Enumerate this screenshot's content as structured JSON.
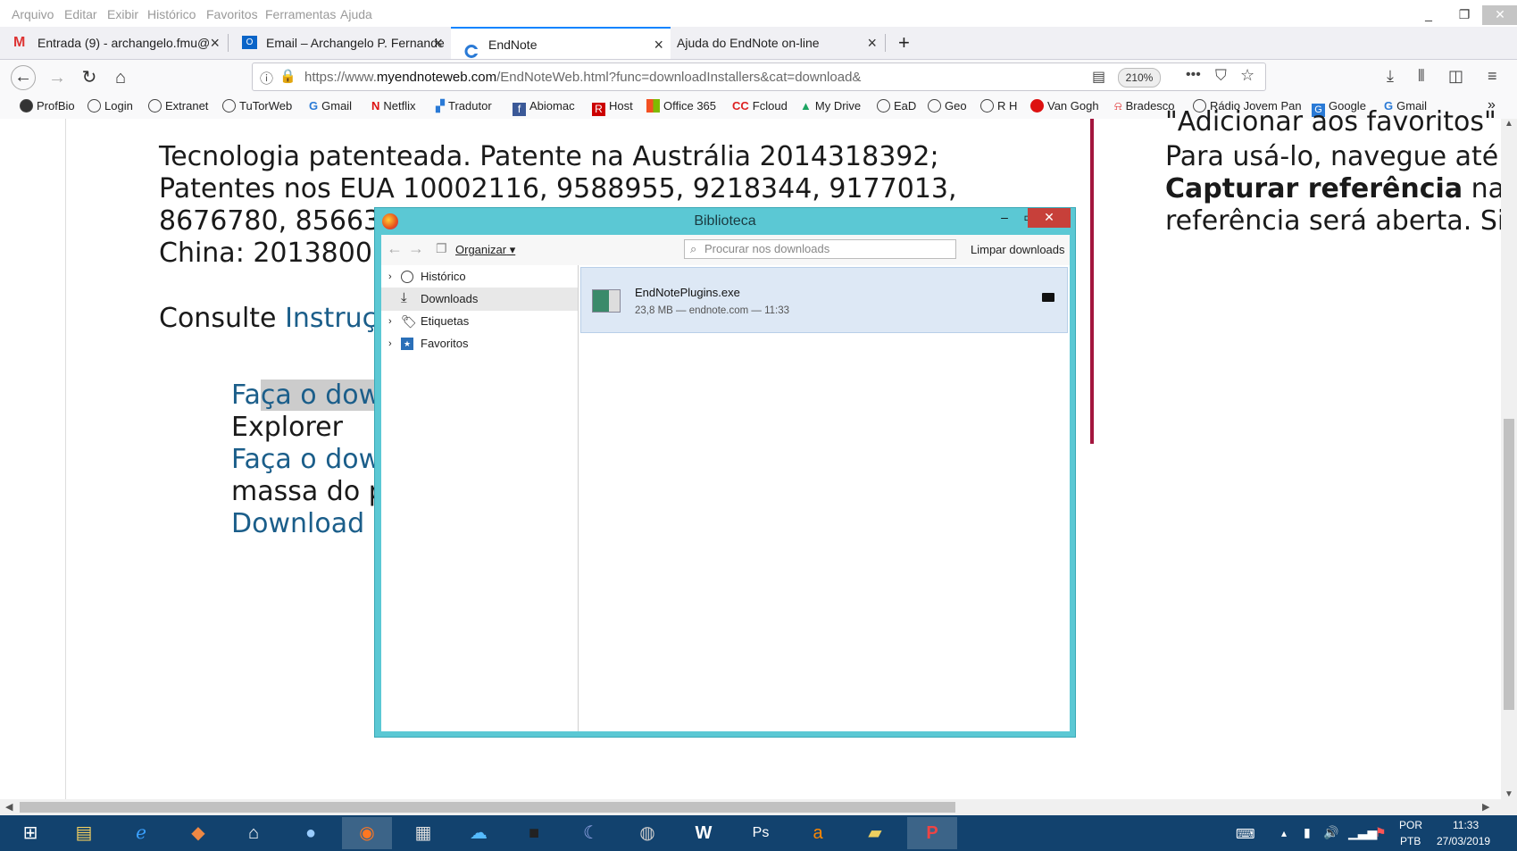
{
  "menubar": {
    "items": [
      "Arquivo",
      "Editar",
      "Exibir",
      "Histórico",
      "Favoritos",
      "Ferramentas",
      "Ajuda"
    ]
  },
  "tabs": [
    {
      "label": "Entrada (9) - archangelo.fmu@",
      "icon": "gmail-icon"
    },
    {
      "label": "Email – Archangelo P. Fernande",
      "icon": "outlook-icon"
    },
    {
      "label": "EndNote",
      "icon": "endnote-icon"
    },
    {
      "label": "Ajuda do EndNote on-line",
      "icon": "none"
    }
  ],
  "urlbar": {
    "url_prefix": "https://www.",
    "url_domain": "myendnoteweb.com",
    "url_rest": "/EndNoteWeb.html?func=downloadInstallers&cat=download&",
    "zoom": "210%"
  },
  "bookmarks": [
    "ProfBio",
    "Login",
    "Extranet",
    "TuTorWeb",
    "Gmail",
    "Netflix",
    "Tradutor",
    "Abiomac",
    "Host",
    "Office 365",
    "Fcloud",
    "My Drive",
    "EaD",
    "Geo",
    "R H",
    "Van Gogh",
    "Bradesco",
    "Rádio Jovem Pan",
    "Google",
    "Gmail"
  ],
  "page": {
    "line1": "Tecnologia patenteada. Patente na Austrália 2014318392;",
    "line2": "Patentes nos EUA 10002116, 9588955, 9218344, 9177013,",
    "line3": "8676780, 85663",
    "line4": "China: 2013800",
    "consult": "Consulte ",
    "consult_link": "Instruç",
    "dl1_a": "Fa",
    "dl1_b": "ça o dow",
    "dl1_c": "Explorer",
    "dl2": "Faça o dow",
    "dl2_c": "massa do p",
    "dl3": "Download p",
    "right1": "\"Adicionar aos favoritos\"",
    "right2": "Para usá-lo, navegue até",
    "right3_bold": "Capturar referência",
    "right3_rest": " na",
    "right4": "referência será aberta. Si"
  },
  "library": {
    "title": "Biblioteca",
    "organize": "Organizar",
    "search_placeholder": "Procurar nos downloads",
    "clear": "Limpar downloads",
    "tree": [
      "Histórico",
      "Downloads",
      "Etiquetas",
      "Favoritos"
    ],
    "download": {
      "filename": "EndNotePlugins.exe",
      "meta": "23,8 MB — endnote.com — 11:33"
    }
  },
  "tray": {
    "lang1": "POR",
    "lang2": "PTB",
    "time": "11:33",
    "date": "27/03/2019"
  },
  "colors": {
    "accent": "#0a84ff",
    "link": "#1b5e8a",
    "divider": "#a3163e",
    "dialog_frame": "#5bc8d4",
    "taskbar": "#12426e"
  }
}
